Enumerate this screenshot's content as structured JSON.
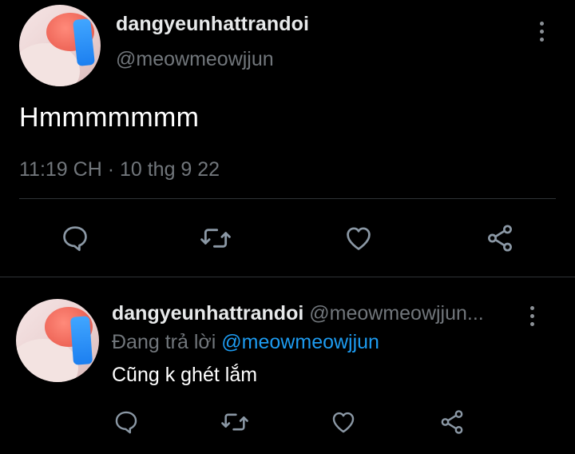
{
  "main_tweet": {
    "display_name": "dangyeunhattrandoi",
    "handle": "@meowmeowjjun",
    "text": "Hmmmmmmm",
    "timestamp": "11:19 CH · 10 thg 9 22",
    "actions": [
      "reply-icon",
      "retweet-icon",
      "like-icon",
      "share-icon"
    ]
  },
  "reply_tweet": {
    "display_name": "dangyeunhattrandoi",
    "handle": "@meowmeowjjun...",
    "replying_prefix": "Đang trả lời",
    "replying_to": "@meowmeowjjun",
    "text": "Cũng k ghét lắm",
    "actions": [
      "reply-icon",
      "retweet-icon",
      "like-icon",
      "share-icon"
    ]
  },
  "colors": {
    "background": "#000000",
    "primary_text": "#e7e9ea",
    "secondary_text": "#71767b",
    "accent": "#1d9bf0",
    "divider": "#2f3336",
    "icon": "#8b98a5"
  }
}
